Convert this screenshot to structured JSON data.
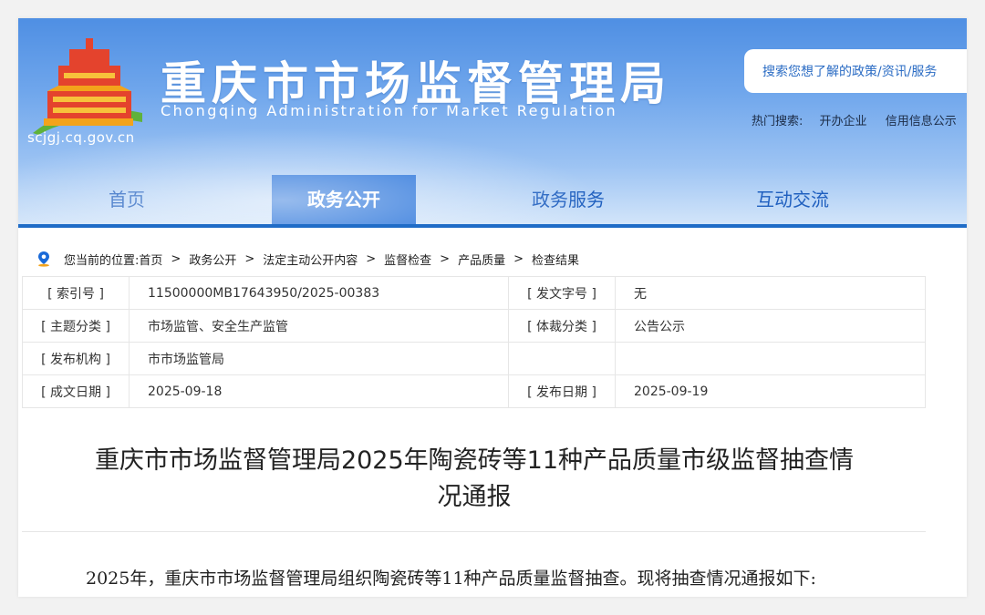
{
  "site": {
    "title": "重庆市市场监督管理局",
    "subtitle": "Chongqing Administration for Market Regulation",
    "domain": "scjgj.cq.gov.cn"
  },
  "search": {
    "placeholder": "搜索您想了解的政策/资讯/服务",
    "hot_label": "热门搜索:",
    "hot_items": [
      "开办企业",
      "信用信息公示"
    ]
  },
  "nav": {
    "items": [
      "首页",
      "政务公开",
      "政务服务",
      "互动交流"
    ],
    "active": "政务公开"
  },
  "breadcrumb": {
    "label": "您当前的位置:",
    "items": [
      "首页",
      "政务公开",
      "法定主动公开内容",
      "监督检查",
      "产品质量",
      "检查结果"
    ]
  },
  "meta": {
    "index_label": "[ 索引号 ]",
    "index_value": "11500000MB17643950/2025-00383",
    "doc_no_label": "[ 发文字号 ]",
    "doc_no_value": "无",
    "topic_label": "[ 主题分类 ]",
    "topic_value": "市场监管、安全生产监管",
    "genre_label": "[ 体裁分类 ]",
    "genre_value": "公告公示",
    "org_label": "[ 发布机构 ]",
    "org_value": "市市场监管局",
    "created_label": "[ 成文日期 ]",
    "created_value": "2025-09-18",
    "published_label": "[ 发布日期 ]",
    "published_value": "2025-09-19"
  },
  "article": {
    "title_line1": "重庆市市场监督管理局2025年陶瓷砖等11种产品质量市级监督抽查情",
    "title_line2": "况通报",
    "intro": "2025年，重庆市市场监督管理局组织陶瓷砖等11种产品质量监督抽查。现将抽查情况通报如下:"
  },
  "colors": {
    "nav_active": "#1a6ad8",
    "nav_text": "#1f5fbf",
    "accent_red": "#e0262a"
  }
}
